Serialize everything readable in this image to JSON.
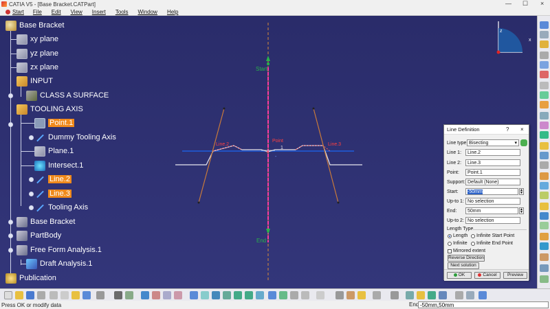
{
  "window": {
    "title": "CATIA V5 - [Base Bracket.CATPart]",
    "controls": [
      "—",
      "☐",
      "×"
    ]
  },
  "menu": [
    "Start",
    "File",
    "Edit",
    "View",
    "Insert",
    "Tools",
    "Window",
    "Help"
  ],
  "tree": {
    "root": "Base Bracket",
    "items": [
      {
        "label": "xy plane",
        "icon": "plane-icon"
      },
      {
        "label": "yz plane",
        "icon": "plane-icon"
      },
      {
        "label": "zx plane",
        "icon": "plane-icon"
      },
      {
        "label": "INPUT",
        "icon": "geometrical-set-icon"
      },
      {
        "label": "CLASS A SURFACE",
        "icon": "surface-icon"
      },
      {
        "label": "TOOLING AXIS",
        "icon": "geometrical-set-icon"
      },
      {
        "label": "Point.1",
        "icon": "point-icon",
        "selected": true
      },
      {
        "label": "Dummy Tooling Axis",
        "icon": "line-icon"
      },
      {
        "label": "Plane.1",
        "icon": "plane-icon"
      },
      {
        "label": "Intersect.1",
        "icon": "intersect-icon"
      },
      {
        "label": "Line.2",
        "icon": "line-icon",
        "selected": true
      },
      {
        "label": "Line.3",
        "icon": "line-icon",
        "selected": true
      },
      {
        "label": "Tooling Axis",
        "icon": "line-icon"
      },
      {
        "label": "Base Bracket",
        "icon": "body-icon"
      },
      {
        "label": "PartBody",
        "icon": "body-icon"
      },
      {
        "label": "Free Form Analysis.1",
        "icon": "analysis-icon"
      },
      {
        "label": "Draft Analysis.1",
        "icon": "draft-analysis-icon"
      },
      {
        "label": "Publication",
        "icon": "publication-icon"
      }
    ]
  },
  "viewport": {
    "labels": {
      "start": "Start",
      "end": "End",
      "point": "Point",
      "line2": "Line.2",
      "line3": "Line.3",
      "one": "1",
      "minus": "-"
    }
  },
  "dialog": {
    "title": "Line Definition",
    "help": "?",
    "close": "×",
    "line_type_label": "Line type :",
    "line_type_value": "Bisecting",
    "line1_label": "Line 1:",
    "line1_value": "Line.2",
    "line2_label": "Line 2:",
    "line2_value": "Line.3",
    "point_label": "Point:",
    "point_value": "Point.1",
    "support_label": "Support:",
    "support_value": "Default (None)",
    "start_label": "Start:",
    "start_value": "-50mm",
    "upto1_label": "Up-to 1:",
    "upto1_value": "No selection",
    "end_label": "End:",
    "end_value": "50mm",
    "upto2_label": "Up-to 2:",
    "upto2_value": "No selection",
    "length_type_label": "Length Type",
    "radio_length": "Length",
    "radio_infinite_start": "Infinite Start Point",
    "radio_infinite": "Infinite",
    "radio_infinite_end": "Infinite End Point",
    "mirrored": "Mirrored extent",
    "reverse": "Reverse Direction",
    "next": "Next solution",
    "ok": "OK",
    "cancel": "Cancel",
    "preview": "Preview"
  },
  "status": {
    "message": "Press OK or modify data",
    "command_label": "End",
    "command_value": "-50mm,50mm"
  },
  "colors": {
    "background": "#2d2f6b",
    "selection": "#f08a1c",
    "axis": "#ff3aa0",
    "line_orange": "#c97a3a",
    "blue_plane": "#1f5fe0",
    "green_marker": "#29b44a"
  }
}
